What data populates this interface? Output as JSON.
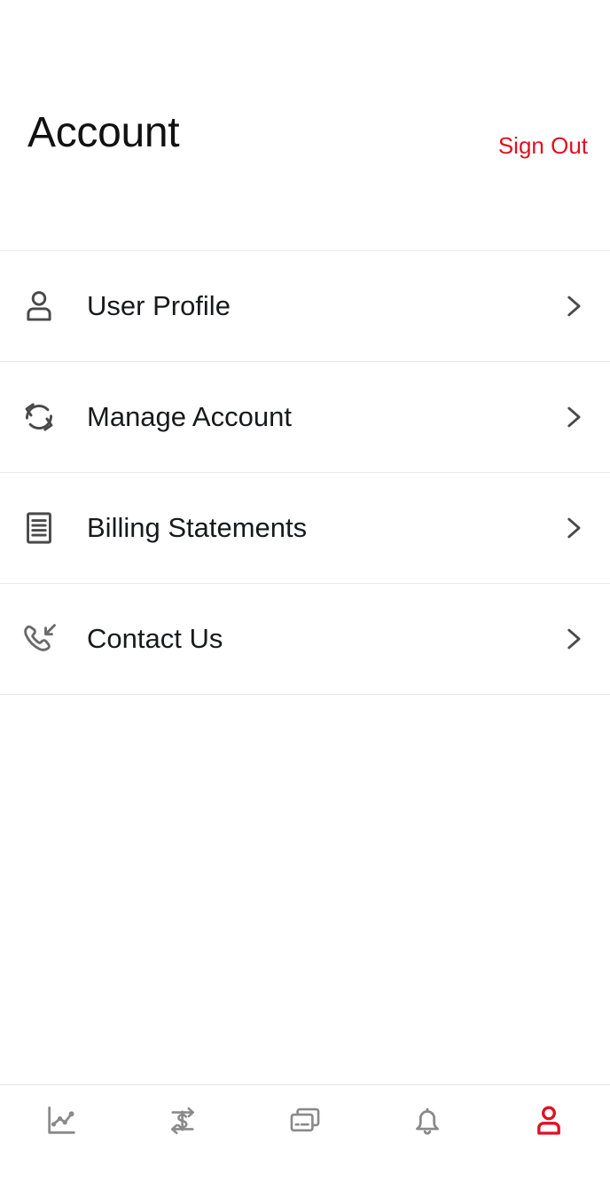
{
  "header": {
    "title": "Account",
    "sign_out_label": "Sign Out",
    "sign_out_color": "#e01020"
  },
  "menu": {
    "items": [
      {
        "label": "User Profile",
        "icon": "person-icon",
        "chevron": "chevron-right-icon"
      },
      {
        "label": "Manage Account",
        "icon": "sync-refresh-icon",
        "chevron": "chevron-right-icon"
      },
      {
        "label": "Billing Statements",
        "icon": "document-lines-icon",
        "chevron": "chevron-right-icon"
      },
      {
        "label": "Contact Us",
        "icon": "incoming-call-icon",
        "chevron": "chevron-right-icon"
      }
    ]
  },
  "bottom_nav": {
    "active_index": 4,
    "active_color": "#e01020",
    "inactive_color": "#8a8a8a",
    "items": [
      {
        "icon": "chart-line-icon",
        "active": false
      },
      {
        "icon": "transfer-dollar-icon",
        "active": false
      },
      {
        "icon": "cards-icon",
        "active": false
      },
      {
        "icon": "bell-icon",
        "active": false
      },
      {
        "icon": "person-icon",
        "active": true
      }
    ]
  },
  "theme": {
    "background": "#ffffff",
    "divider": "#e8e8e8",
    "text": "#17191c",
    "icon_gray": "#4a4a4a"
  }
}
